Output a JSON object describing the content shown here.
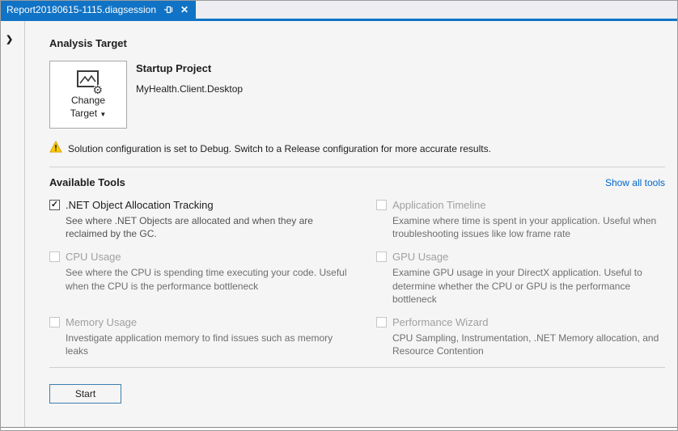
{
  "tab": {
    "title": "Report20180615-1115.diagsession",
    "pin_icon": "pin",
    "close_glyph": "✕"
  },
  "left_rail": {
    "expand_chevron": "❯"
  },
  "analysis_target": {
    "heading": "Analysis Target",
    "change_target": {
      "line1": "Change",
      "line2": "Target",
      "caret": "▼"
    },
    "target_type": "Startup Project",
    "target_name": "MyHealth.Client.Desktop"
  },
  "warning": {
    "text": "Solution configuration is set to Debug. Switch to a Release configuration for more accurate results."
  },
  "available_tools": {
    "heading": "Available Tools",
    "show_all_link": "Show all tools",
    "tools": [
      {
        "label": ".NET Object Allocation Tracking",
        "description": "See where .NET Objects are allocated and when they are reclaimed by the GC.",
        "checked": true,
        "enabled": true,
        "check_glyph": "✓"
      },
      {
        "label": "Application Timeline",
        "description": "Examine where time is spent in your application. Useful when troubleshooting issues like low frame rate",
        "checked": false,
        "enabled": false,
        "check_glyph": ""
      },
      {
        "label": "CPU Usage",
        "description": "See where the CPU is spending time executing your code. Useful when the CPU is the performance bottleneck",
        "checked": false,
        "enabled": false,
        "check_glyph": ""
      },
      {
        "label": "GPU Usage",
        "description": "Examine GPU usage in your DirectX application. Useful to determine whether the CPU or GPU is the performance bottleneck",
        "checked": false,
        "enabled": false,
        "check_glyph": ""
      },
      {
        "label": "Memory Usage",
        "description": "Investigate application memory to find issues such as memory leaks",
        "checked": false,
        "enabled": false,
        "check_glyph": ""
      },
      {
        "label": "Performance Wizard",
        "description": "CPU Sampling, Instrumentation, .NET Memory allocation, and Resource Contention",
        "checked": false,
        "enabled": false,
        "check_glyph": ""
      }
    ]
  },
  "actions": {
    "start_label": "Start"
  },
  "colors": {
    "tab_blue": "#1073C5",
    "link_blue": "#0066CC",
    "warning_yellow": "#FFCC00",
    "start_border_blue": "#3C7FB1"
  }
}
